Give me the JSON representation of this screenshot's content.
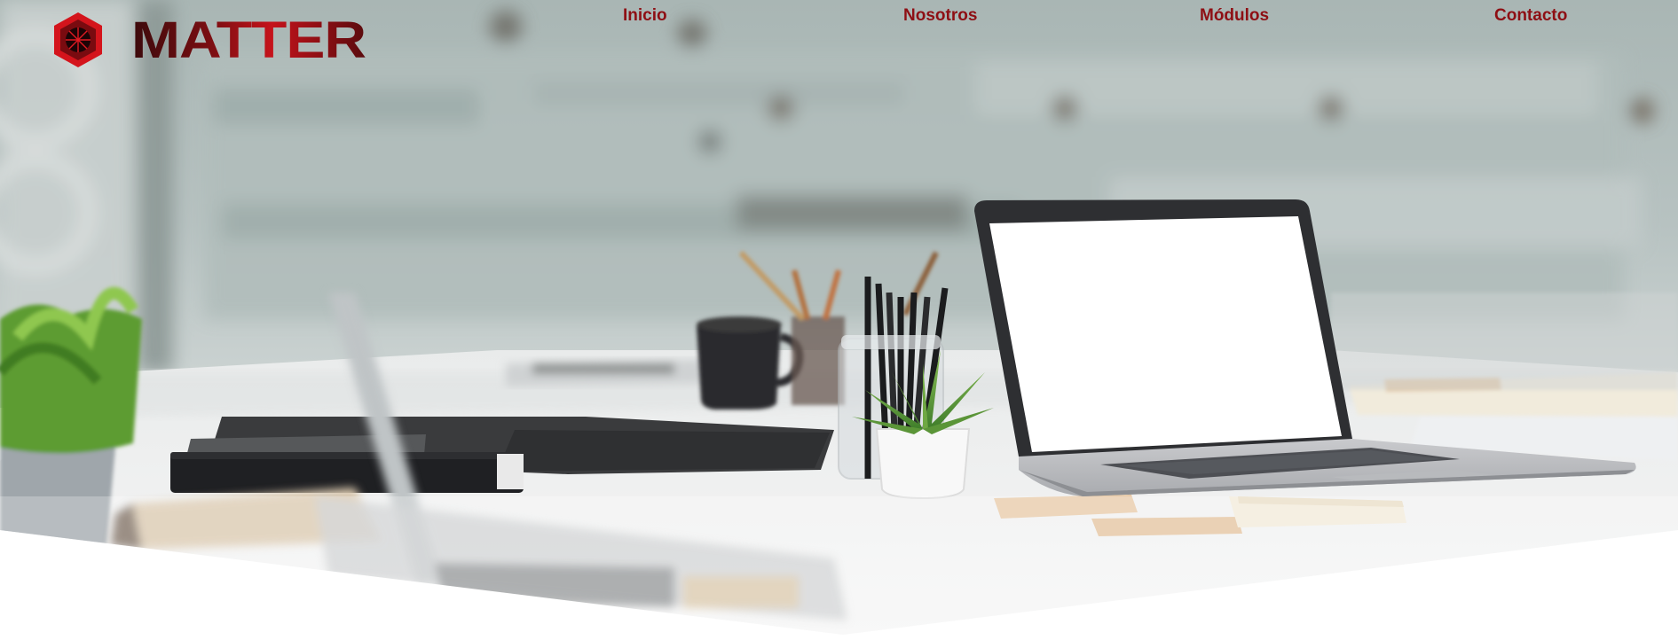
{
  "brand": {
    "name": "MATTER",
    "logo_icon": "hexagon-logo-icon",
    "colors": {
      "primary": "#c5131b",
      "dark": "#3b0a0c",
      "nav_text": "#8e0f14"
    }
  },
  "nav": {
    "items": [
      {
        "label": "Inicio"
      },
      {
        "label": "Nosotros"
      },
      {
        "label": "Módulos"
      },
      {
        "label": "Contacto"
      }
    ]
  },
  "hero": {
    "image_subject": "office-desk-laptop-photo"
  }
}
